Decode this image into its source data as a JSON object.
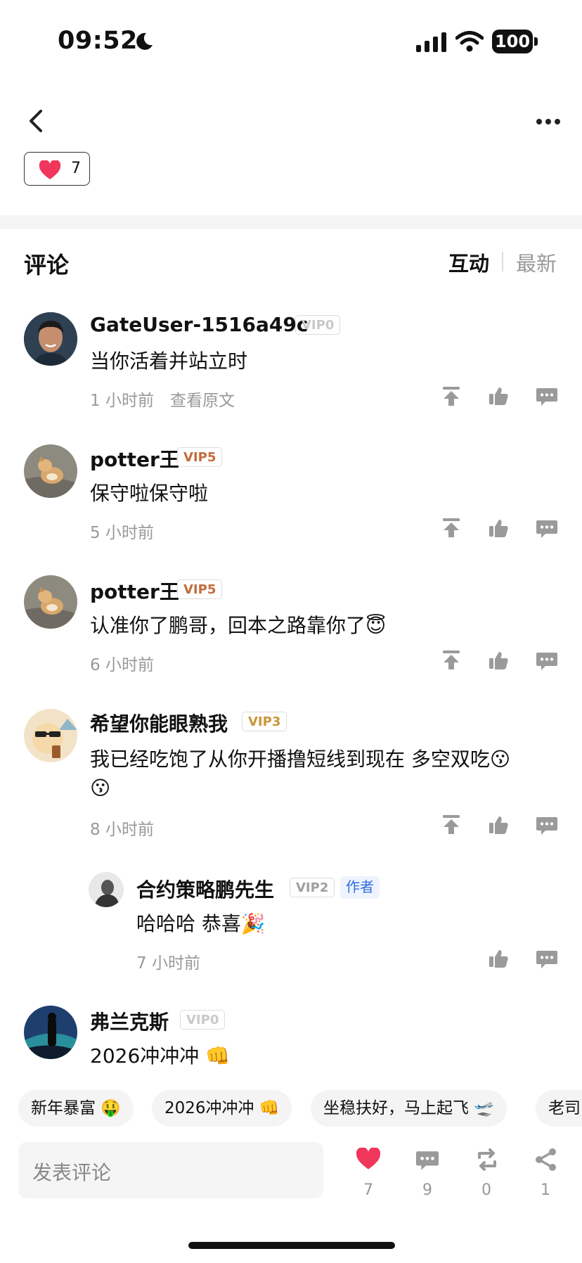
{
  "status": {
    "time": "09:52",
    "battery": "100"
  },
  "post": {
    "like_count": "7"
  },
  "comments_header": {
    "title": "评论",
    "tab_interact": "互动",
    "tab_latest": "最新"
  },
  "comments": [
    {
      "name": "GateUser-1516a49c",
      "vip": "VIP0",
      "text": "当你活着并站立时",
      "time": "1 小时前",
      "extra": "查看原文"
    },
    {
      "name": "potter王",
      "vip": "VIP5",
      "text": "保守啦保守啦",
      "time": "5 小时前"
    },
    {
      "name": "potter王",
      "vip": "VIP5",
      "text": "认准你了鹏哥，回本之路靠你了😇",
      "time": "6 小时前"
    },
    {
      "name": "希望你能眼熟我",
      "vip": "VIP3",
      "text_line1": "我已经吃饱了从你开播撸短线到现在 多空双吃😗",
      "text_line2": "😗",
      "time": "8 小时前"
    },
    {
      "name": "合约策略鹏先生",
      "vip": "VIP2",
      "author_badge": "作者",
      "text": "哈哈哈 恭喜🎉",
      "time": "7 小时前"
    },
    {
      "name": "弗兰克斯",
      "vip": "VIP0",
      "text": "2026冲冲冲 👊"
    }
  ],
  "quick_replies": [
    "新年暴富 🤑",
    "2026冲冲冲 👊",
    "坐稳扶好，马上起飞 🛫",
    "老司"
  ],
  "bottom_bar": {
    "input_placeholder": "发表评论",
    "likes": "7",
    "comments": "9",
    "reposts": "0",
    "shares": "1"
  },
  "colors": {
    "heart": "#f0365b",
    "icon_gray": "#9a9a9a",
    "author_blue": "#2f6de1"
  }
}
